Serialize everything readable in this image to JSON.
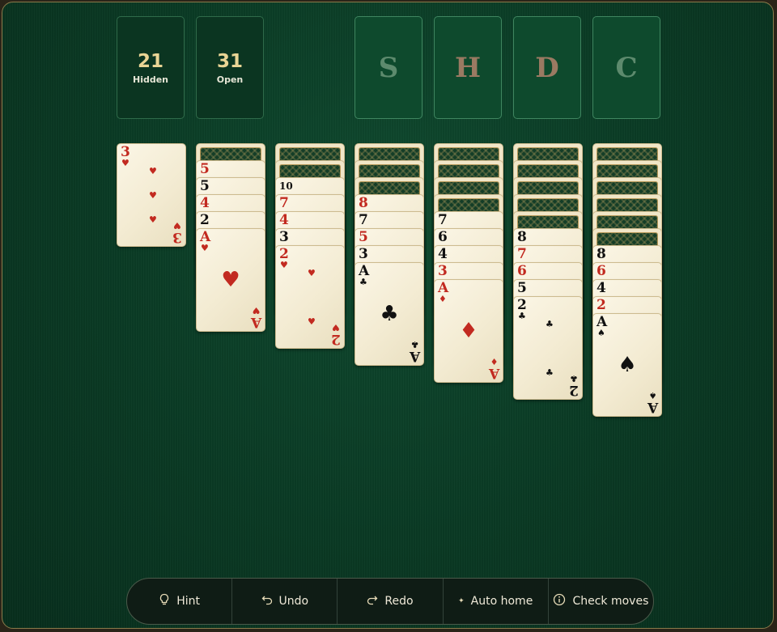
{
  "counters": {
    "hidden": {
      "value": "21",
      "label": "Hidden"
    },
    "open": {
      "value": "31",
      "label": "Open"
    }
  },
  "foundations": [
    {
      "letter": "S",
      "color": "#5d8a6d"
    },
    {
      "letter": "H",
      "color": "#9a7a62"
    },
    {
      "letter": "D",
      "color": "#9a7a62"
    },
    {
      "letter": "C",
      "color": "#5d8a6d"
    }
  ],
  "tableau": [
    {
      "hidden": 0,
      "cards": [
        {
          "rank": "3",
          "suit": "heart",
          "color": "red"
        }
      ]
    },
    {
      "hidden": 1,
      "cards": [
        {
          "rank": "5",
          "suit": "heart",
          "color": "red"
        },
        {
          "rank": "5",
          "suit": "spade",
          "color": "black"
        },
        {
          "rank": "4",
          "suit": "diamond",
          "color": "red"
        },
        {
          "rank": "2",
          "suit": "club",
          "color": "black"
        },
        {
          "rank": "A",
          "suit": "heart",
          "color": "red"
        }
      ]
    },
    {
      "hidden": 2,
      "cards": [
        {
          "rank": "10",
          "suit": "spade",
          "color": "black"
        },
        {
          "rank": "7",
          "suit": "heart",
          "color": "red"
        },
        {
          "rank": "4",
          "suit": "heart",
          "color": "red"
        },
        {
          "rank": "3",
          "suit": "club",
          "color": "black"
        },
        {
          "rank": "2",
          "suit": "heart",
          "color": "red"
        }
      ]
    },
    {
      "hidden": 3,
      "cards": [
        {
          "rank": "8",
          "suit": "diamond",
          "color": "red"
        },
        {
          "rank": "7",
          "suit": "spade",
          "color": "black"
        },
        {
          "rank": "5",
          "suit": "diamond",
          "color": "red"
        },
        {
          "rank": "3",
          "suit": "spade",
          "color": "black"
        },
        {
          "rank": "A",
          "suit": "club",
          "color": "black"
        }
      ]
    },
    {
      "hidden": 4,
      "cards": [
        {
          "rank": "7",
          "suit": "club",
          "color": "black"
        },
        {
          "rank": "6",
          "suit": "spade",
          "color": "black"
        },
        {
          "rank": "4",
          "suit": "club",
          "color": "black"
        },
        {
          "rank": "3",
          "suit": "diamond",
          "color": "red"
        },
        {
          "rank": "A",
          "suit": "diamond",
          "color": "red"
        }
      ]
    },
    {
      "hidden": 5,
      "cards": [
        {
          "rank": "8",
          "suit": "club",
          "color": "black"
        },
        {
          "rank": "7",
          "suit": "heart",
          "color": "red"
        },
        {
          "rank": "6",
          "suit": "diamond",
          "color": "red"
        },
        {
          "rank": "5",
          "suit": "spade",
          "color": "black"
        },
        {
          "rank": "2",
          "suit": "club",
          "color": "black"
        }
      ]
    },
    {
      "hidden": 6,
      "cards": [
        {
          "rank": "8",
          "suit": "spade",
          "color": "black"
        },
        {
          "rank": "6",
          "suit": "heart",
          "color": "red"
        },
        {
          "rank": "4",
          "suit": "spade",
          "color": "black"
        },
        {
          "rank": "2",
          "suit": "diamond",
          "color": "red"
        },
        {
          "rank": "A",
          "suit": "spade",
          "color": "black"
        }
      ]
    }
  ],
  "toolbar": [
    {
      "icon": "lightbulb-icon",
      "label": "Hint"
    },
    {
      "icon": "undo-icon",
      "label": "Undo"
    },
    {
      "icon": "redo-icon",
      "label": "Redo"
    },
    {
      "icon": "sparkle-icon",
      "label": "Auto home"
    },
    {
      "icon": "info-icon",
      "label": "Check moves"
    }
  ]
}
